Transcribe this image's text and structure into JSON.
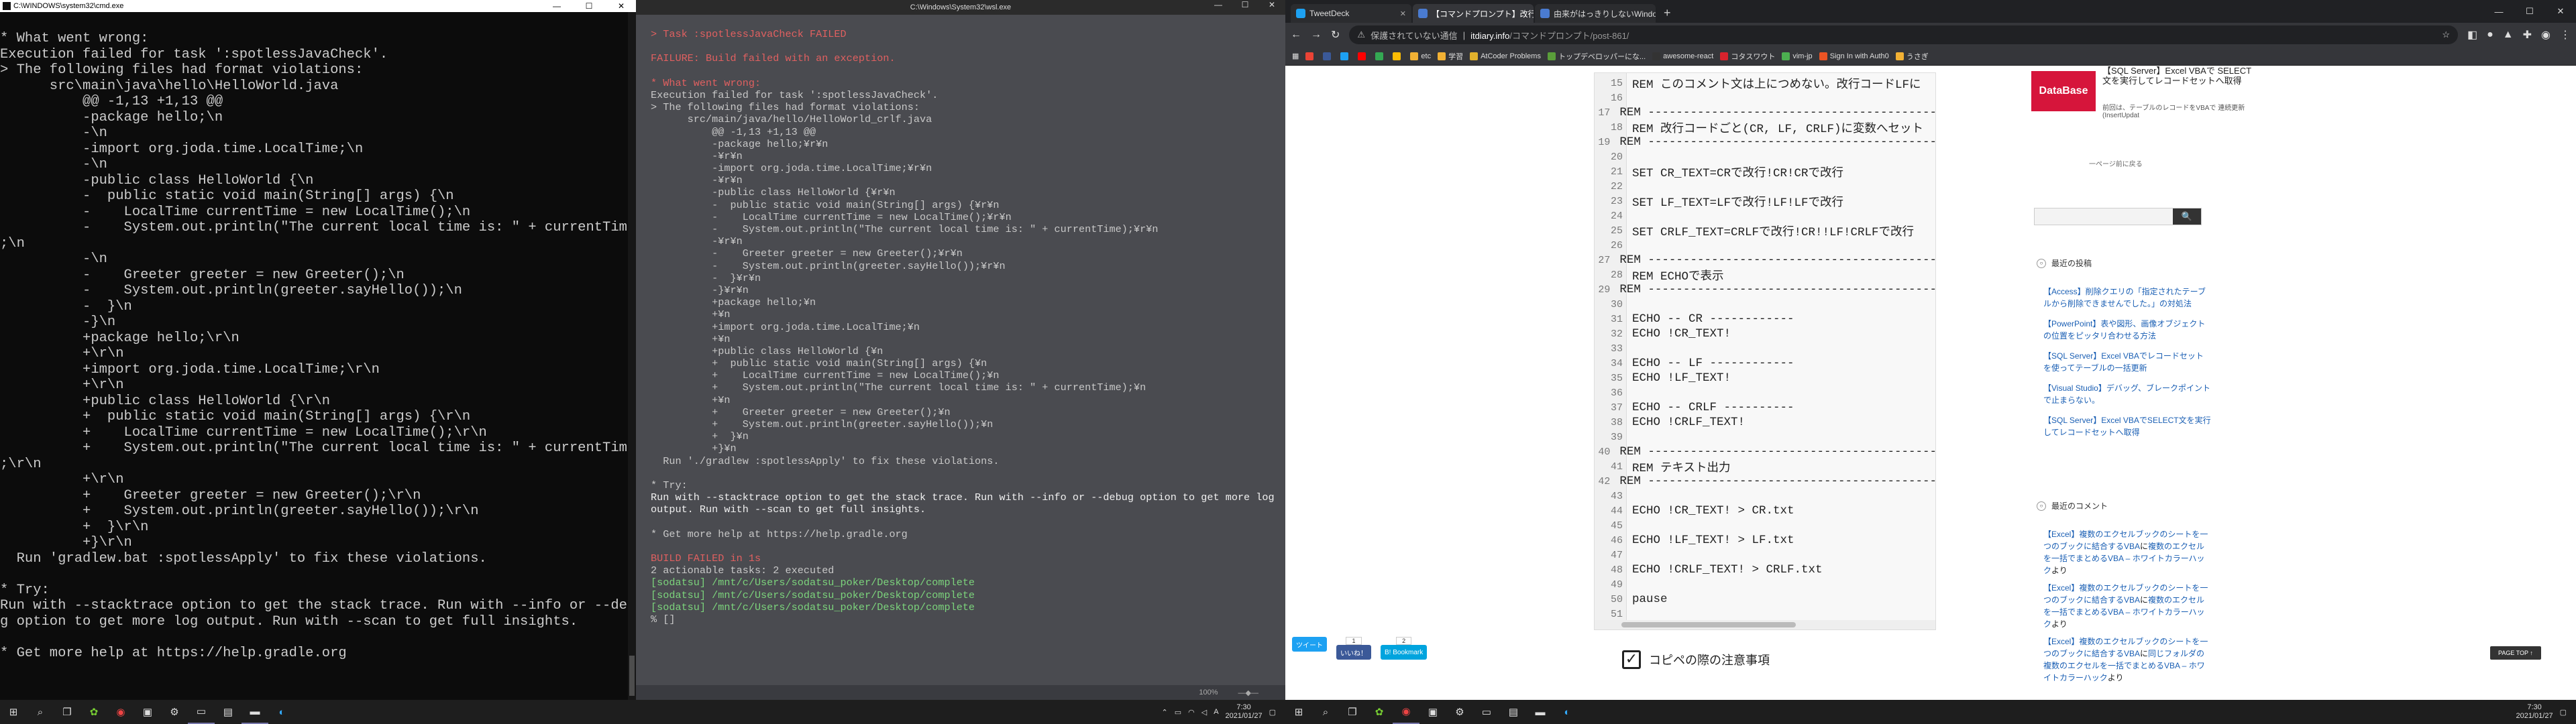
{
  "cmd": {
    "title": "C:\\WINDOWS\\system32\\cmd.exe",
    "lines": [
      "* What went wrong:",
      "Execution failed for task ':spotlessJavaCheck'.",
      "> The following files had format violations:",
      "      src\\main\\java\\hello\\HelloWorld.java",
      "          @@ -1,13 +1,13 @@",
      "          -package hello;\\n",
      "          -\\n",
      "          -import org.joda.time.LocalTime;\\n",
      "          -\\n",
      "          -public class HelloWorld {\\n",
      "          -  public static void main(String[] args) {\\n",
      "          -    LocalTime currentTime = new LocalTime();\\n",
      "          -    System.out.println(\"The current local time is: \" + currentTime)",
      ";\\n",
      "          -\\n",
      "          -    Greeter greeter = new Greeter();\\n",
      "          -    System.out.println(greeter.sayHello());\\n",
      "          -  }\\n",
      "          -}\\n",
      "          +package hello;\\r\\n",
      "          +\\r\\n",
      "          +import org.joda.time.LocalTime;\\r\\n",
      "          +\\r\\n",
      "          +public class HelloWorld {\\r\\n",
      "          +  public static void main(String[] args) {\\r\\n",
      "          +    LocalTime currentTime = new LocalTime();\\r\\n",
      "          +    System.out.println(\"The current local time is: \" + currentTime)",
      ";\\r\\n",
      "          +\\r\\n",
      "          +    Greeter greeter = new Greeter();\\r\\n",
      "          +    System.out.println(greeter.sayHello());\\r\\n",
      "          +  }\\r\\n",
      "          +}\\r\\n",
      "  Run 'gradlew.bat :spotlessApply' to fix these violations.",
      "",
      "* Try:",
      "Run with --stacktrace option to get the stack trace. Run with --info or --debu",
      "g option to get more log output. Run with --scan to get full insights.",
      "",
      "* Get more help at https://help.gradle.org"
    ]
  },
  "mid": {
    "title": "C:\\Windows\\System32\\wsl.exe",
    "lines": [
      {
        "t": "> Task :spotlessJavaCheck FAILED",
        "c": "red"
      },
      {
        "t": "",
        "c": ""
      },
      {
        "t": "FAILURE: Build failed with an exception.",
        "c": "red"
      },
      {
        "t": "",
        "c": ""
      },
      {
        "t": "* What went wrong:",
        "c": "red"
      },
      {
        "t": "Execution failed for task ':spotlessJavaCheck'.",
        "c": ""
      },
      {
        "t": "> The following files had format violations:",
        "c": ""
      },
      {
        "t": "      src/main/java/hello/HelloWorld_crlf.java",
        "c": ""
      },
      {
        "t": "          @@ -1,13 +1,13 @@",
        "c": ""
      },
      {
        "t": "          -package hello;¥r¥n",
        "c": ""
      },
      {
        "t": "          -¥r¥n",
        "c": ""
      },
      {
        "t": "          -import org.joda.time.LocalTime;¥r¥n",
        "c": ""
      },
      {
        "t": "          -¥r¥n",
        "c": ""
      },
      {
        "t": "          -public class HelloWorld {¥r¥n",
        "c": ""
      },
      {
        "t": "          -  public static void main(String[] args) {¥r¥n",
        "c": ""
      },
      {
        "t": "          -    LocalTime currentTime = new LocalTime();¥r¥n",
        "c": ""
      },
      {
        "t": "          -    System.out.println(\"The current local time is: \" + currentTime);¥r¥n",
        "c": ""
      },
      {
        "t": "          -¥r¥n",
        "c": ""
      },
      {
        "t": "          -    Greeter greeter = new Greeter();¥r¥n",
        "c": ""
      },
      {
        "t": "          -    System.out.println(greeter.sayHello());¥r¥n",
        "c": ""
      },
      {
        "t": "          -  }¥r¥n",
        "c": ""
      },
      {
        "t": "          -}¥r¥n",
        "c": ""
      },
      {
        "t": "          +package hello;¥n",
        "c": ""
      },
      {
        "t": "          +¥n",
        "c": ""
      },
      {
        "t": "          +import org.joda.time.LocalTime;¥n",
        "c": ""
      },
      {
        "t": "          +¥n",
        "c": ""
      },
      {
        "t": "          +public class HelloWorld {¥n",
        "c": ""
      },
      {
        "t": "          +  public static void main(String[] args) {¥n",
        "c": ""
      },
      {
        "t": "          +    LocalTime currentTime = new LocalTime();¥n",
        "c": ""
      },
      {
        "t": "          +    System.out.println(\"The current local time is: \" + currentTime);¥n",
        "c": ""
      },
      {
        "t": "          +¥n",
        "c": ""
      },
      {
        "t": "          +    Greeter greeter = new Greeter();¥n",
        "c": ""
      },
      {
        "t": "          +    System.out.println(greeter.sayHello());¥n",
        "c": ""
      },
      {
        "t": "          +  }¥n",
        "c": ""
      },
      {
        "t": "          +}¥n",
        "c": ""
      },
      {
        "t": "  Run './gradlew :spotlessApply' to fix these violations.",
        "c": ""
      },
      {
        "t": "",
        "c": ""
      },
      {
        "t": "* Try:",
        "c": ""
      },
      {
        "t": "Run with --stacktrace option to get the stack trace. Run with --info or --debug option to get more log",
        "c": "wht"
      },
      {
        "t": "output. Run with --scan to get full insights.",
        "c": "wht"
      },
      {
        "t": "",
        "c": ""
      },
      {
        "t": "* Get more help at https://help.gradle.org",
        "c": ""
      },
      {
        "t": "",
        "c": ""
      },
      {
        "t": "BUILD FAILED in 1s",
        "c": "red"
      },
      {
        "t": "2 actionable tasks: 2 executed",
        "c": ""
      },
      {
        "t": "[sodatsu] /mnt/c/Users/sodatsu_poker/Desktop/complete",
        "c": "grn"
      },
      {
        "t": "[sodatsu] /mnt/c/Users/sodatsu_poker/Desktop/complete",
        "c": "grn"
      },
      {
        "t": "[sodatsu] /mnt/c/Users/sodatsu_poker/Desktop/complete",
        "c": "grn"
      },
      {
        "t": "% []",
        "c": ""
      }
    ],
    "status_zoom": "100%"
  },
  "browser": {
    "tabs": [
      {
        "label": "TweetDeck",
        "color": "#1da1f2",
        "active": false
      },
      {
        "label": "【コマンドプロンプト】改行コードCR, LF",
        "color": "#4a7bd0",
        "active": true
      },
      {
        "label": "由来がはっきりしないWindowsの改行",
        "color": "#4a7bd0",
        "active": false
      }
    ],
    "new_tab": "+",
    "security": "保護されていない通信",
    "domain": "itdiary.info",
    "path": "/コマンドプロンプト/post-861/",
    "bookmarks": [
      {
        "label": "",
        "color": "#ea4335"
      },
      {
        "label": "",
        "color": "#3b5998"
      },
      {
        "label": "",
        "color": "#1da1f2"
      },
      {
        "label": "",
        "color": "#ff0000"
      },
      {
        "label": "",
        "color": "#34a853"
      },
      {
        "label": "",
        "color": "#fbbc05"
      },
      {
        "label": "etc",
        "color": "#f2b134"
      },
      {
        "label": "学習",
        "color": "#f2b134"
      },
      {
        "label": "AtCoder Problems",
        "color": "#e1b12c"
      },
      {
        "label": "トップデベロッパーにな...",
        "color": "#5a9e3a"
      },
      {
        "label": "awesome-react",
        "color": "#333"
      },
      {
        "label": "コタスワウト",
        "color": "#d9232d"
      },
      {
        "label": "vim-jp",
        "color": "#4caf50"
      },
      {
        "label": "Sign In with Auth0",
        "color": "#eb5424"
      },
      {
        "label": "うさぎ",
        "color": "#f2b134"
      }
    ],
    "code_lines": [
      {
        "n": "15",
        "t": "REM このコメント文は上につめない。改行コードLFに"
      },
      {
        "n": "16",
        "t": ""
      },
      {
        "n": "17",
        "t": "REM -----------------------------------------"
      },
      {
        "n": "18",
        "t": "REM 改行コードごと(CR, LF, CRLF)に変数へセット"
      },
      {
        "n": "19",
        "t": "REM -----------------------------------------"
      },
      {
        "n": "20",
        "t": ""
      },
      {
        "n": "21",
        "t": "SET CR_TEXT=CRで改行!CR!CRで改行"
      },
      {
        "n": "22",
        "t": ""
      },
      {
        "n": "23",
        "t": "SET LF_TEXT=LFで改行!LF!LFで改行"
      },
      {
        "n": "24",
        "t": ""
      },
      {
        "n": "25",
        "t": "SET CRLF_TEXT=CRLFで改行!CR!!LF!CRLFで改行"
      },
      {
        "n": "26",
        "t": ""
      },
      {
        "n": "27",
        "t": "REM -----------------------------------------"
      },
      {
        "n": "28",
        "t": "REM ECHOで表示"
      },
      {
        "n": "29",
        "t": "REM -----------------------------------------"
      },
      {
        "n": "30",
        "t": ""
      },
      {
        "n": "31",
        "t": "ECHO -- CR ------------"
      },
      {
        "n": "32",
        "t": "ECHO !CR_TEXT!"
      },
      {
        "n": "33",
        "t": ""
      },
      {
        "n": "34",
        "t": "ECHO -- LF ------------"
      },
      {
        "n": "35",
        "t": "ECHO !LF_TEXT!"
      },
      {
        "n": "36",
        "t": ""
      },
      {
        "n": "37",
        "t": "ECHO -- CRLF ----------"
      },
      {
        "n": "38",
        "t": "ECHO !CRLF_TEXT!"
      },
      {
        "n": "39",
        "t": ""
      },
      {
        "n": "40",
        "t": "REM -----------------------------------------"
      },
      {
        "n": "41",
        "t": "REM テキスト出力"
      },
      {
        "n": "42",
        "t": "REM -----------------------------------------"
      },
      {
        "n": "43",
        "t": ""
      },
      {
        "n": "44",
        "t": "ECHO !CR_TEXT! > CR.txt"
      },
      {
        "n": "45",
        "t": ""
      },
      {
        "n": "46",
        "t": "ECHO !LF_TEXT! > LF.txt"
      },
      {
        "n": "47",
        "t": ""
      },
      {
        "n": "48",
        "t": "ECHO !CRLF_TEXT! > CRLF.txt"
      },
      {
        "n": "49",
        "t": ""
      },
      {
        "n": "50",
        "t": "pause"
      },
      {
        "n": "51",
        "t": ""
      }
    ],
    "copy_heading": "コピペの際の注意事項",
    "share": {
      "tweet": "ツイート",
      "like": "いいね！",
      "hatena": "B! Bookmark",
      "like_count": "1",
      "hatena_count": "2"
    },
    "ad": {
      "logo": "DataBase",
      "title": "【SQL Server】Excel VBAで SELECT文を実行してレコードセットへ取得",
      "desc": "前回は、テーブルのレコードをVBAで 連続更新(InsertUpdat"
    },
    "back_to_top": "一ページ前に戻る",
    "search_button": "🔍",
    "recent_posts_heading": "最近の投稿",
    "recent_posts": [
      "【Access】削除クエリの「指定されたテーブルから削除できませんでした。」の対処法",
      "【PowerPoint】表や図形、画像オブジェクトの位置をピッタリ合わせる方法",
      "【SQL Server】Excel VBAでレコードセットを使ってテーブルの一括更新",
      "【Visual Studio】デバッグ、ブレークポイントで止まらない。",
      "【SQL Server】Excel VBAでSELECT文を実行してレコードセットへ取得"
    ],
    "recent_comments_heading": "最近のコメント",
    "recent_comments": [
      {
        "link": "【Excel】複数のエクセルブックのシートを一つのブックに結合するVBA",
        "pre": "に",
        "more": "複数のエクセルを一括でまとめるVBA – ホワイトカラーハック",
        "suf": "より"
      },
      {
        "link": "【Excel】複数のエクセルブックのシートを一つのブックに結合するVBA",
        "pre": "に",
        "more": "複数のエクセルを一括でまとめるVBA – ホワイトカラーハック",
        "suf": "より"
      },
      {
        "link": "【Excel】複数のエクセルブックのシートを一つのブックに結合するVBA",
        "pre": "に",
        "more": "同じフォルダの複数のエクセルを一括でまとめるVBA – ホワイトカラーハック",
        "suf": "より"
      }
    ],
    "page_top": "PAGE TOP ↑"
  },
  "taskbar": {
    "left_clock": {
      "time": "7:30",
      "date": "2021/01/27"
    },
    "right_clock": {
      "time": "7:30",
      "date": "2021/01/27"
    },
    "ime": "A"
  }
}
